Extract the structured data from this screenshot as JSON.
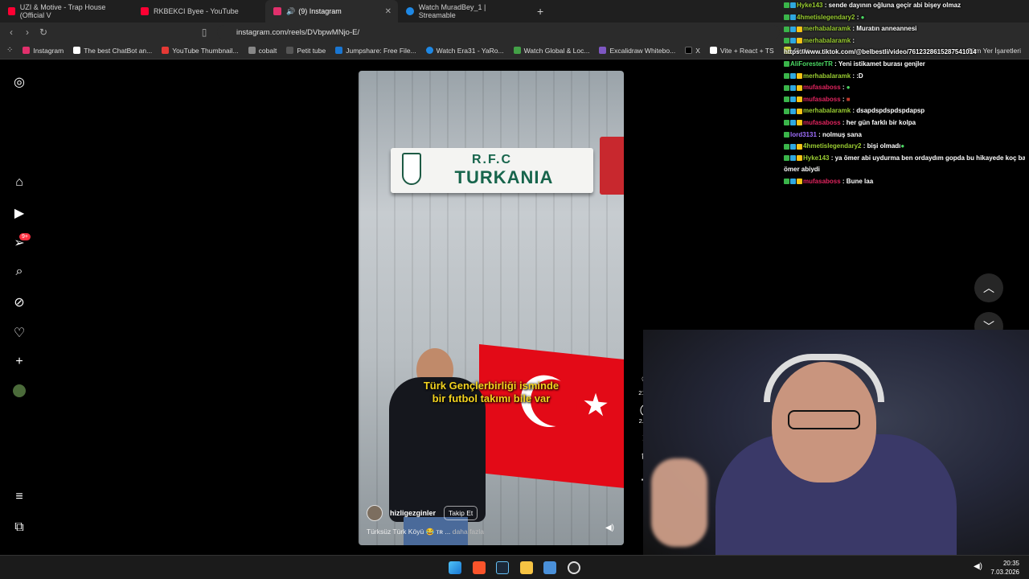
{
  "browser": {
    "tabs": [
      {
        "label": "UZI & Motive - Trap House (Official V",
        "color": "#ff0033"
      },
      {
        "label": "RKBEKCI Byee - YouTube",
        "color": "#ff0033"
      },
      {
        "label": "(9) Instagram",
        "color": "#e1306c",
        "active": true
      },
      {
        "label": "Watch MuradBey_1 | Streamable",
        "color": "#1e88e5"
      }
    ],
    "new_tab": "+",
    "url": "instagram.com/reels/DVbpwMNjo-E/",
    "bookmarks": [
      {
        "label": "Instagram",
        "color": "#e1306c"
      },
      {
        "label": "The best ChatBot an...",
        "color": "#ffffff"
      },
      {
        "label": "YouTube Thumbnail...",
        "color": "#e53935"
      },
      {
        "label": "cobalt",
        "color": "#888888"
      },
      {
        "label": "Petit tube",
        "color": "#555555"
      },
      {
        "label": "Jumpshare: Free File...",
        "color": "#1976d2"
      },
      {
        "label": "Watch Era31 - YaRo...",
        "color": "#1e88e5"
      },
      {
        "label": "Watch Global & Loc...",
        "color": "#43a047"
      },
      {
        "label": "Excalidraw Whitebo...",
        "color": "#7e57c2"
      },
      {
        "label": "X",
        "color": "#000000"
      },
      {
        "label": "Vite + React + TS",
        "color": "#ffffff"
      },
      {
        "label": "file.io",
        "color": "#cddc39"
      }
    ],
    "bookmarks_right": "Tüm Yer İşaretleri"
  },
  "reel": {
    "sign_line1": "R.F.C",
    "sign_line2": "TURKANIA",
    "caption_line1": "Türk Gençlerbirliği isminde",
    "caption_line2": "bir futbol takımı bile var",
    "author": "hizligezginler",
    "follow": "Takip Et",
    "description": "Türksüz Türk Köyü 😂 ᴛʀ ...",
    "more": "daha fazla",
    "likes": "215 B",
    "comments": "2.283"
  },
  "chat": [
    {
      "user": "Hyke143",
      "text": "sende dayının oğluna geçir abi bişey olmaz",
      "color": "#9acd32"
    },
    {
      "user": "4hmetislegendary2",
      "text": "",
      "color": "#9acd32"
    },
    {
      "user": "merhabalaramk",
      "text": "Muratın anneannesi",
      "color": "#9acd32"
    },
    {
      "user": "merhabalaramk",
      "text": "",
      "color": "#9acd32"
    },
    {
      "user": "",
      "text": "https://www.tiktok.com/@belbestli/video/7612328615287541014",
      "color": "#ffffff"
    },
    {
      "user": "AliForesterTR",
      "text": "Yeni istikamet burası genjler",
      "color": "#4cd964"
    },
    {
      "user": "merhabalaramk",
      "text": ":D",
      "color": "#9acd32"
    },
    {
      "user": "mufasaboss",
      "text": "",
      "color": "#e0245e"
    },
    {
      "user": "mufasaboss",
      "text": "",
      "color": "#e0245e"
    },
    {
      "user": "merhabalaramk",
      "text": "dsapdspdspdspdapsp",
      "color": "#9acd32"
    },
    {
      "user": "mufasaboss",
      "text": "her gün farklı bir kolpa",
      "color": "#e0245e"
    },
    {
      "user": "lord3131",
      "text": "nolmuş sana",
      "color": "#a070ff"
    },
    {
      "user": "4hmetislegendary2",
      "text": "bişi olmadı",
      "color": "#9acd32"
    },
    {
      "user": "Hyke143",
      "text": "ya ömer abi uydurma ben ordaydım gopda bu hikayede koç başı",
      "color": "#9acd32"
    },
    {
      "user": "",
      "text": "ömer abiydi",
      "color": "#ffffff"
    },
    {
      "user": "mufasaboss",
      "text": "Bune laa",
      "color": "#e0245e"
    }
  ],
  "clock": {
    "time": "20:35",
    "date": "7.03.2026"
  }
}
